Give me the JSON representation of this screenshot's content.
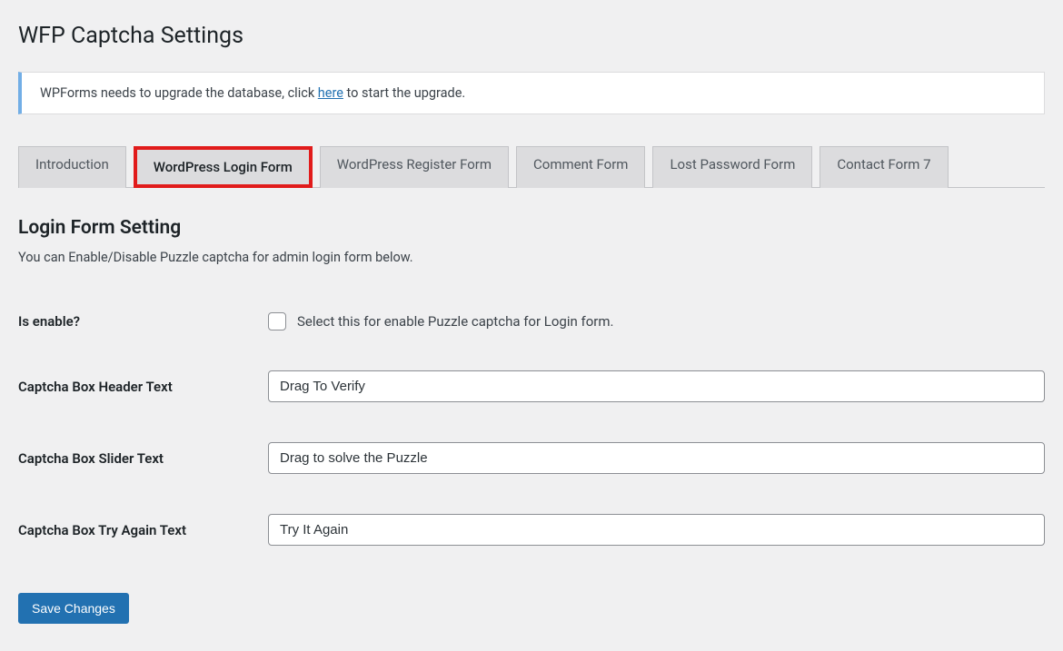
{
  "page": {
    "title": "WFP Captcha Settings"
  },
  "notice": {
    "prefix": "WPForms needs to upgrade the database, click ",
    "link": "here",
    "suffix": " to start the upgrade."
  },
  "tabs": [
    {
      "label": "Introduction",
      "highlight": false
    },
    {
      "label": "WordPress Login Form",
      "highlight": true
    },
    {
      "label": "WordPress Register Form",
      "highlight": false
    },
    {
      "label": "Comment Form",
      "highlight": false
    },
    {
      "label": "Lost Password Form",
      "highlight": false
    },
    {
      "label": "Contact Form 7",
      "highlight": false
    }
  ],
  "section": {
    "title": "Login Form Setting",
    "desc": "You can Enable/Disable Puzzle captcha for admin login form below."
  },
  "fields": {
    "enable_label": "Is enable?",
    "enable_desc": "Select this for enable Puzzle captcha for Login form.",
    "header_label": "Captcha Box Header Text",
    "header_value": "Drag To Verify",
    "slider_label": "Captcha Box Slider Text",
    "slider_value": "Drag to solve the Puzzle",
    "tryagain_label": "Captcha Box Try Again Text",
    "tryagain_value": "Try It Again"
  },
  "buttons": {
    "save": "Save Changes"
  }
}
